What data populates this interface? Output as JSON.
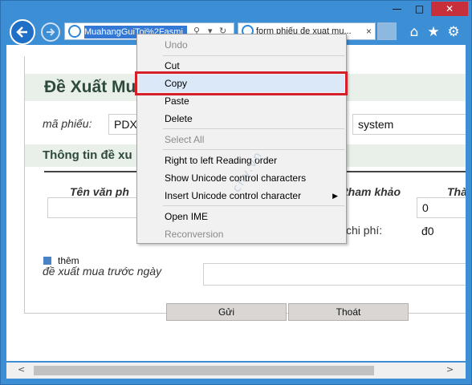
{
  "browser": {
    "address_url": "MuahangGuiToi%2Fasmi",
    "tab_title": "form phiếu đe xuat mu...",
    "tab_close": "×",
    "icons": [
      "back-arrow-icon",
      "forward-arrow-icon",
      "ie-icon",
      "search-icon",
      "refresh-icon",
      "home-icon",
      "star-icon",
      "gear-icon"
    ]
  },
  "window_controls": {
    "minimize": "—",
    "maximize": "□",
    "close": "✕"
  },
  "page": {
    "title": "Đề Xuất Mu",
    "ma_phieu_label": "mã phiếu:",
    "ma_phieu_value": "PDX",
    "user_value": "system",
    "section2_title": "Thông tin đề xu",
    "col_ten": "Tên văn ph",
    "col_tham_khao": "tham khảo",
    "col_tha": "Thà",
    "qty_value": "0",
    "chi_phi_label": "chi phí:",
    "chi_phi_value": "đ0",
    "them_label": "thêm",
    "de_xuat_label": "đề xuất mua trước ngày",
    "gui_button": "Gửi",
    "thoat_button": "Thoát"
  },
  "context_menu": {
    "items": [
      {
        "label": "Undo",
        "enabled": false
      },
      {
        "label": "Cut",
        "enabled": true
      },
      {
        "label": "Copy",
        "enabled": true,
        "highlighted": true
      },
      {
        "label": "Paste",
        "enabled": true
      },
      {
        "label": "Delete",
        "enabled": true
      },
      {
        "label": "Select All",
        "enabled": false
      },
      {
        "label": "Right to left Reading order",
        "enabled": true
      },
      {
        "label": "Show Unicode control characters",
        "enabled": true
      },
      {
        "label": "Insert Unicode control character",
        "enabled": true,
        "submenu": true
      },
      {
        "label": "Open IME",
        "enabled": true
      },
      {
        "label": "Reconversion",
        "enabled": false
      }
    ],
    "submenu_arrow": "▶"
  },
  "watermark": "cnv.vn",
  "colors": {
    "titlebar": "#3c8fd4",
    "close": "#c7303a",
    "highlight_box": "#d4202a",
    "section_bg": "#e9efe9"
  }
}
